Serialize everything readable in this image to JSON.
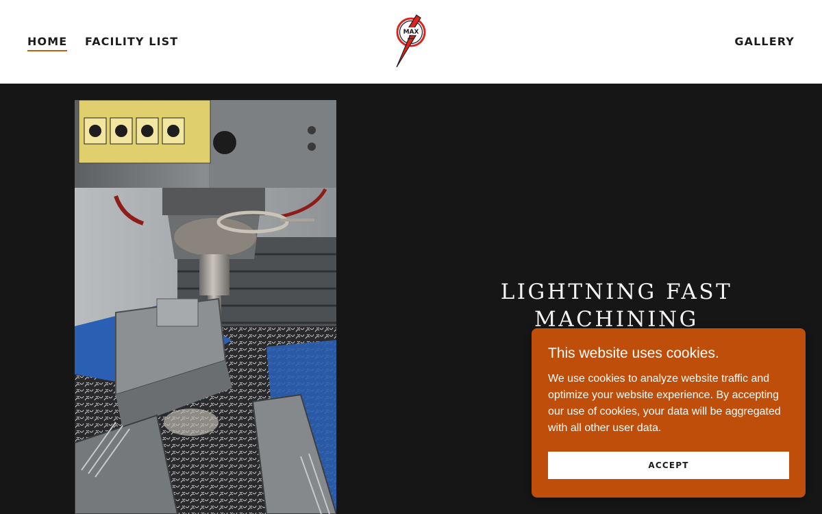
{
  "header": {
    "nav_left": [
      {
        "label": "HOME",
        "active": true
      },
      {
        "label": "FACILITY LIST",
        "active": false
      }
    ],
    "nav_right": [
      {
        "label": "GALLERY",
        "active": false
      }
    ],
    "logo": {
      "text": "MAX",
      "icon": "lightning-bolt-logo",
      "colors": [
        "#d9251d",
        "#1b1b1b",
        "#ffffff"
      ]
    }
  },
  "hero": {
    "title": "LIGHTNING FAST MACHINING",
    "image": {
      "subject": "milling machine cutting metal with chips on the table",
      "icon": "machining-photo"
    }
  },
  "cookie_banner": {
    "title": "This website uses cookies.",
    "body": "We use cookies to analyze website traffic and optimize your website experience. By accepting our use of cookies, your data will be aggregated with all other user data.",
    "accept_label": "ACCEPT"
  },
  "colors": {
    "accent": "#c45c14",
    "hero_background": "#161616",
    "cookie_background": "#c04e0b",
    "text_dark": "#1b1b1b"
  }
}
